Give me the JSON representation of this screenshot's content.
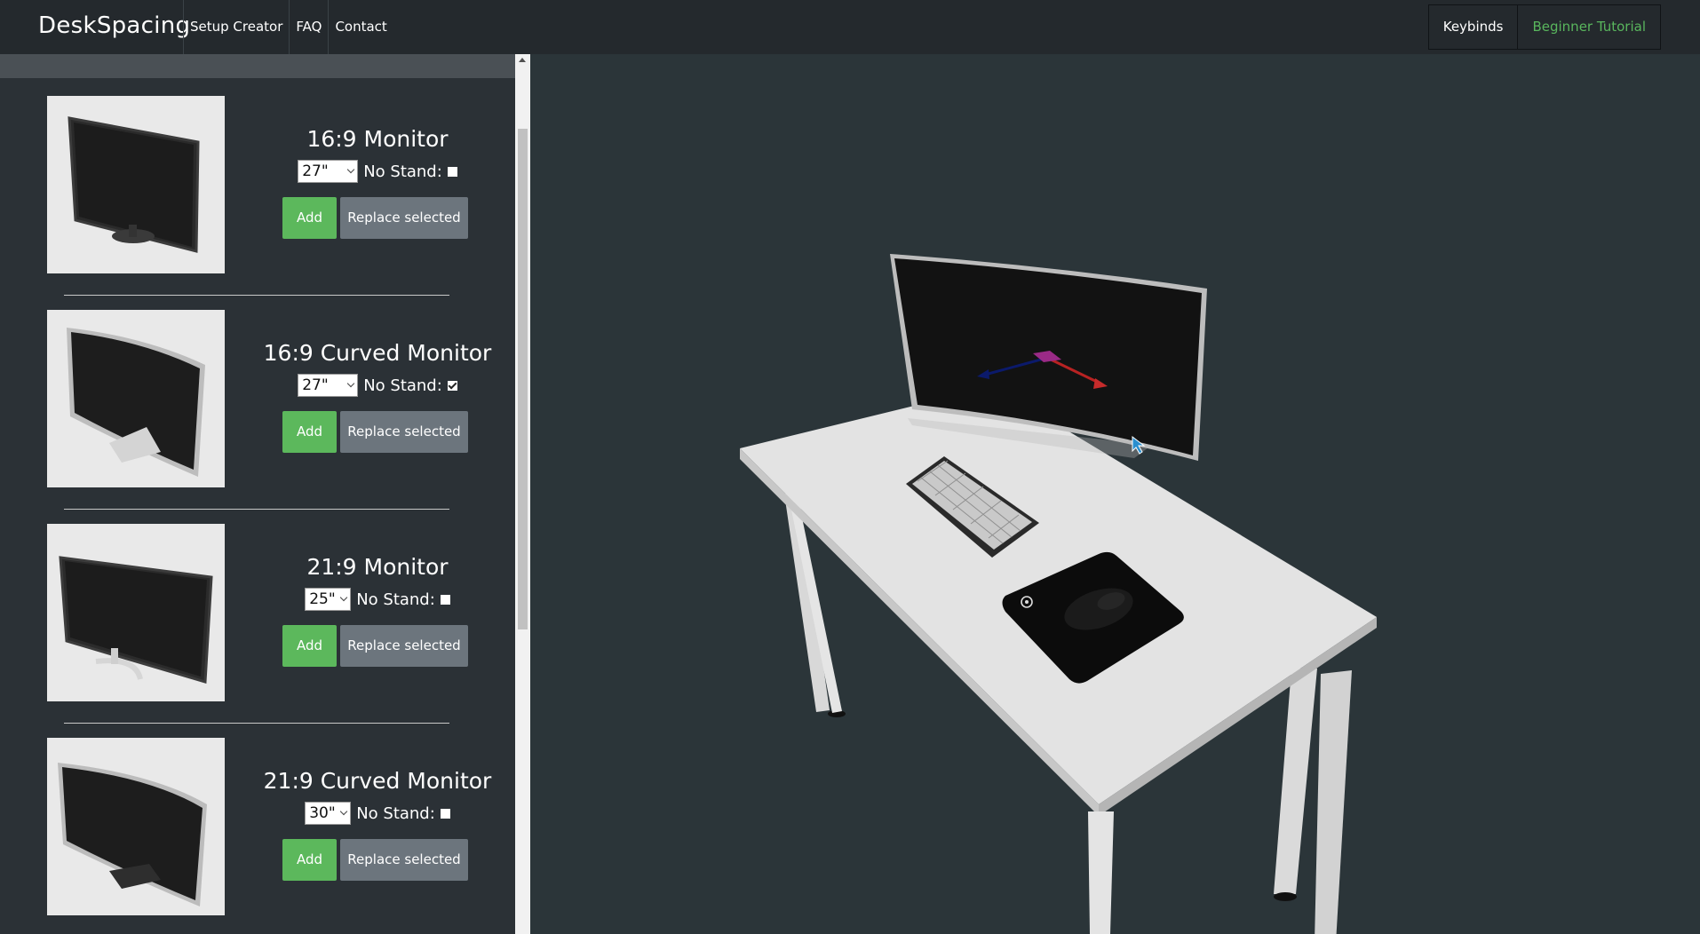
{
  "navbar": {
    "brand": "DeskSpacing",
    "links": [
      "Setup Creator",
      "FAQ",
      "Contact"
    ],
    "keybinds_label": "Keybinds",
    "tutorial_label": "Beginner Tutorial"
  },
  "products": [
    {
      "title": "16:9 Monitor",
      "size": "27\"",
      "no_stand_label": "No Stand:",
      "no_stand_checked": false,
      "add_label": "Add",
      "replace_label": "Replace selected"
    },
    {
      "title": "16:9 Curved Monitor",
      "size": "27\"",
      "no_stand_label": "No Stand:",
      "no_stand_checked": true,
      "add_label": "Add",
      "replace_label": "Replace selected"
    },
    {
      "title": "21:9 Monitor",
      "size": "25\"",
      "no_stand_label": "No Stand:",
      "no_stand_checked": false,
      "add_label": "Add",
      "replace_label": "Replace selected"
    },
    {
      "title": "21:9 Curved Monitor",
      "size": "30\"",
      "no_stand_label": "No Stand:",
      "no_stand_checked": false,
      "add_label": "Add",
      "replace_label": "Replace selected"
    }
  ],
  "colors": {
    "accent_green": "#5cb85c",
    "tutorial_text": "#59b65d",
    "navbar_bg": "#24292d",
    "sidebar_bg": "#2b3136",
    "viewport_bg": "#2b3539"
  }
}
